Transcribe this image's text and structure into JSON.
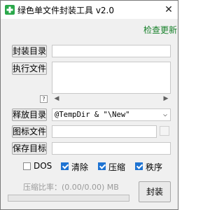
{
  "window": {
    "title": "绿色单文件封装工具 v2.0",
    "close_glyph": "✕"
  },
  "header": {
    "check_update": "检查更新"
  },
  "form": {
    "package_dir": {
      "label": "封装目录",
      "value": ""
    },
    "exec_file": {
      "label": "执行文件",
      "value": ""
    },
    "help": "?",
    "release_dir": {
      "label": "释放目录",
      "value": "@TempDir & \"\\New\""
    },
    "icon_file": {
      "label": "图标文件",
      "value": ""
    },
    "save_target": {
      "label": "保存目标",
      "value": ""
    }
  },
  "options": [
    {
      "label": "DOS",
      "checked": false
    },
    {
      "label": "清除",
      "checked": true
    },
    {
      "label": "压缩",
      "checked": true
    },
    {
      "label": "秩序",
      "checked": true
    }
  ],
  "status": {
    "ratio_text": "压缩比率：(0.00/0.00) MB",
    "progress": 0
  },
  "actions": {
    "package_label": "封装"
  },
  "colors": {
    "link": "#17802a",
    "check_accent": "#1e73d2",
    "app_icon_green": "#2aa84a"
  },
  "icons": {
    "app": "green-plus-icon",
    "close": "close-icon",
    "dropdown": "chevron-down-icon",
    "scroll_left": "arrow-left-icon",
    "scroll_right": "arrow-right-icon"
  }
}
